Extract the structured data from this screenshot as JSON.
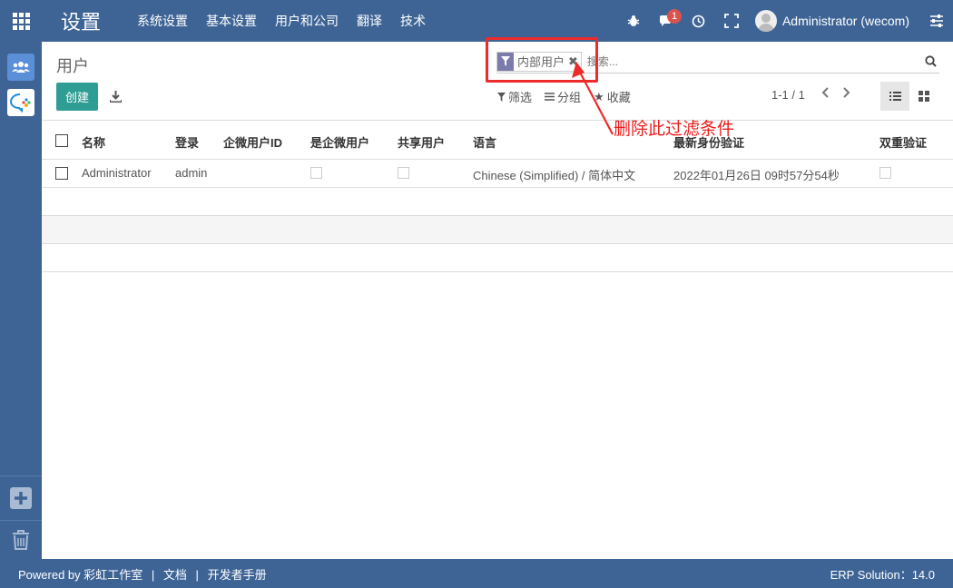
{
  "app": {
    "title": "设置"
  },
  "menu": [
    "系统设置",
    "基本设置",
    "用户和公司",
    "翻译",
    "技术"
  ],
  "systray": {
    "message_count": "1",
    "user_name": "Administrator (wecom)"
  },
  "breadcrumb": "用户",
  "search": {
    "facet_label": "内部用户",
    "placeholder": "搜索..."
  },
  "buttons": {
    "create": "创建"
  },
  "search_options": {
    "filter": "筛选",
    "group": "分组",
    "favorite": "收藏"
  },
  "pager": "1-1 / 1",
  "table": {
    "headers": [
      "名称",
      "登录",
      "企微用户ID",
      "是企微用户",
      "共享用户",
      "语言",
      "最新身份验证",
      "双重验证"
    ],
    "rows": [
      {
        "name": "Administrator",
        "login": "admin",
        "wecom_id": "",
        "language": "Chinese (Simplified) / 简体中文",
        "last_auth": "2022年01月26日 09时57分54秒"
      }
    ]
  },
  "annotation": {
    "text": "删除此过滤条件"
  },
  "footer": {
    "powered_by": "Powered by 彩虹工作室",
    "docs": "文档",
    "dev_manual": "开发者手册",
    "separator": "|",
    "version": "ERP Solution：14.0"
  },
  "colors": {
    "navbar": "#3e6496",
    "create_button": "#2e9e94",
    "facet_icon": "#7c7bad",
    "annotation": "#ee2b2b"
  }
}
